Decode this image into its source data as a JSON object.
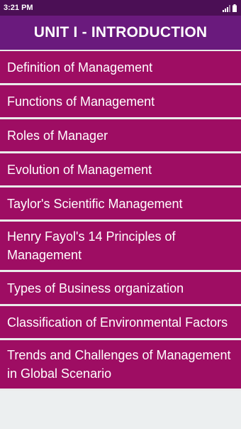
{
  "status_bar": {
    "time": "3:21 PM"
  },
  "header": {
    "title": "UNIT I - INTRODUCTION"
  },
  "topics": [
    "Definition of Management",
    "Functions of Management",
    "Roles of Manager",
    "Evolution of Management",
    "Taylor's Scientific Management",
    "Henry Fayol's 14 Principles of Management",
    "Types of Business organization",
    "Classification of Environmental Factors",
    "Trends and Challenges of Management in Global Scenario"
  ],
  "colors": {
    "status_bar": "#4b0f55",
    "header": "#6a1a7d",
    "list_item": "#9e0d63",
    "divider": "#eaeaea"
  }
}
